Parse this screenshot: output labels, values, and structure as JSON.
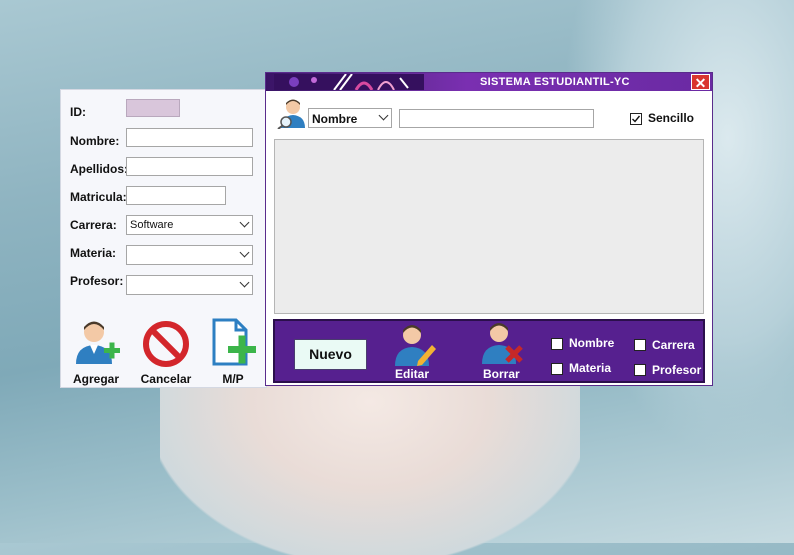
{
  "form": {
    "id_label": "ID:",
    "nombre_label": "Nombre:",
    "apellidos_label": "Apellidos:",
    "matricula_label": "Matricula:",
    "carrera_label": "Carrera:",
    "carrera_value": "Software",
    "materia_label": "Materia:",
    "profesor_label": "Profesor:",
    "agregar_label": "Agregar",
    "cancelar_label": "Cancelar",
    "mp_label": "M/P"
  },
  "window": {
    "title": "SISTEMA ESTUDIANTIL-YC",
    "close_glyph": "✕",
    "search_field_value": "Nombre",
    "sencillo_label": "Sencillo",
    "sencillo_checked": true,
    "nuevo_label": "Nuevo",
    "editar_label": "Editar",
    "borrar_label": "Borrar",
    "filters": {
      "nombre": "Nombre",
      "materia": "Materia",
      "carrera": "Carrera",
      "profesor": "Profesor"
    }
  },
  "colors": {
    "accent_purple": "#56208f",
    "close_red": "#d9362e",
    "add_green": "#3cb54a",
    "cancel_red": "#d3262b"
  },
  "icons": [
    "user-search-icon",
    "add-user-icon",
    "cancel-icon",
    "add-file-icon",
    "edit-user-icon",
    "delete-user-icon",
    "checkbox-icon"
  ]
}
